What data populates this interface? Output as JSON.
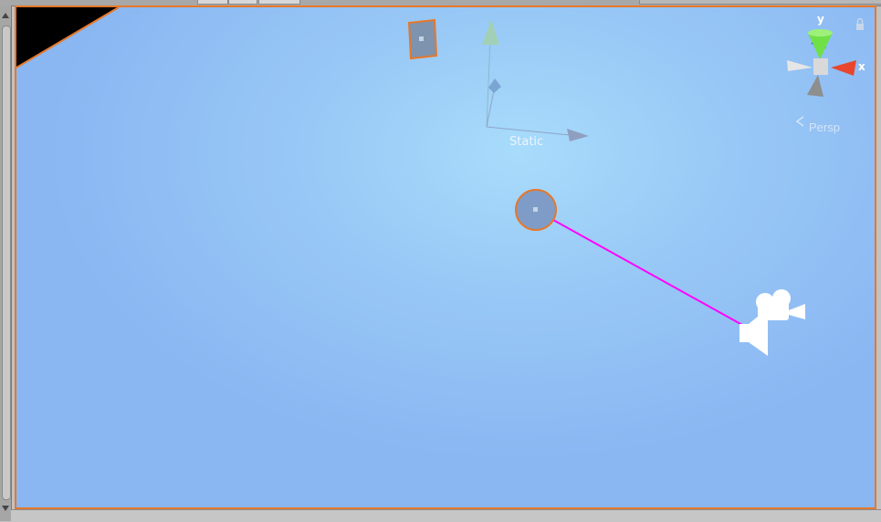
{
  "scene": {
    "static_label": "Static",
    "persp_label": "Persp",
    "axis_y": "y",
    "axis_x": "x"
  },
  "icons": {
    "camera": "camera-icon",
    "audio": "speaker-icon",
    "lock": "lock-icon"
  },
  "colors": {
    "selection_outline": "#e6782a",
    "link_line": "#ff00ff",
    "axis_x": "#e8472e",
    "axis_y": "#6fe046",
    "axis_z": "#3d7bd9"
  }
}
